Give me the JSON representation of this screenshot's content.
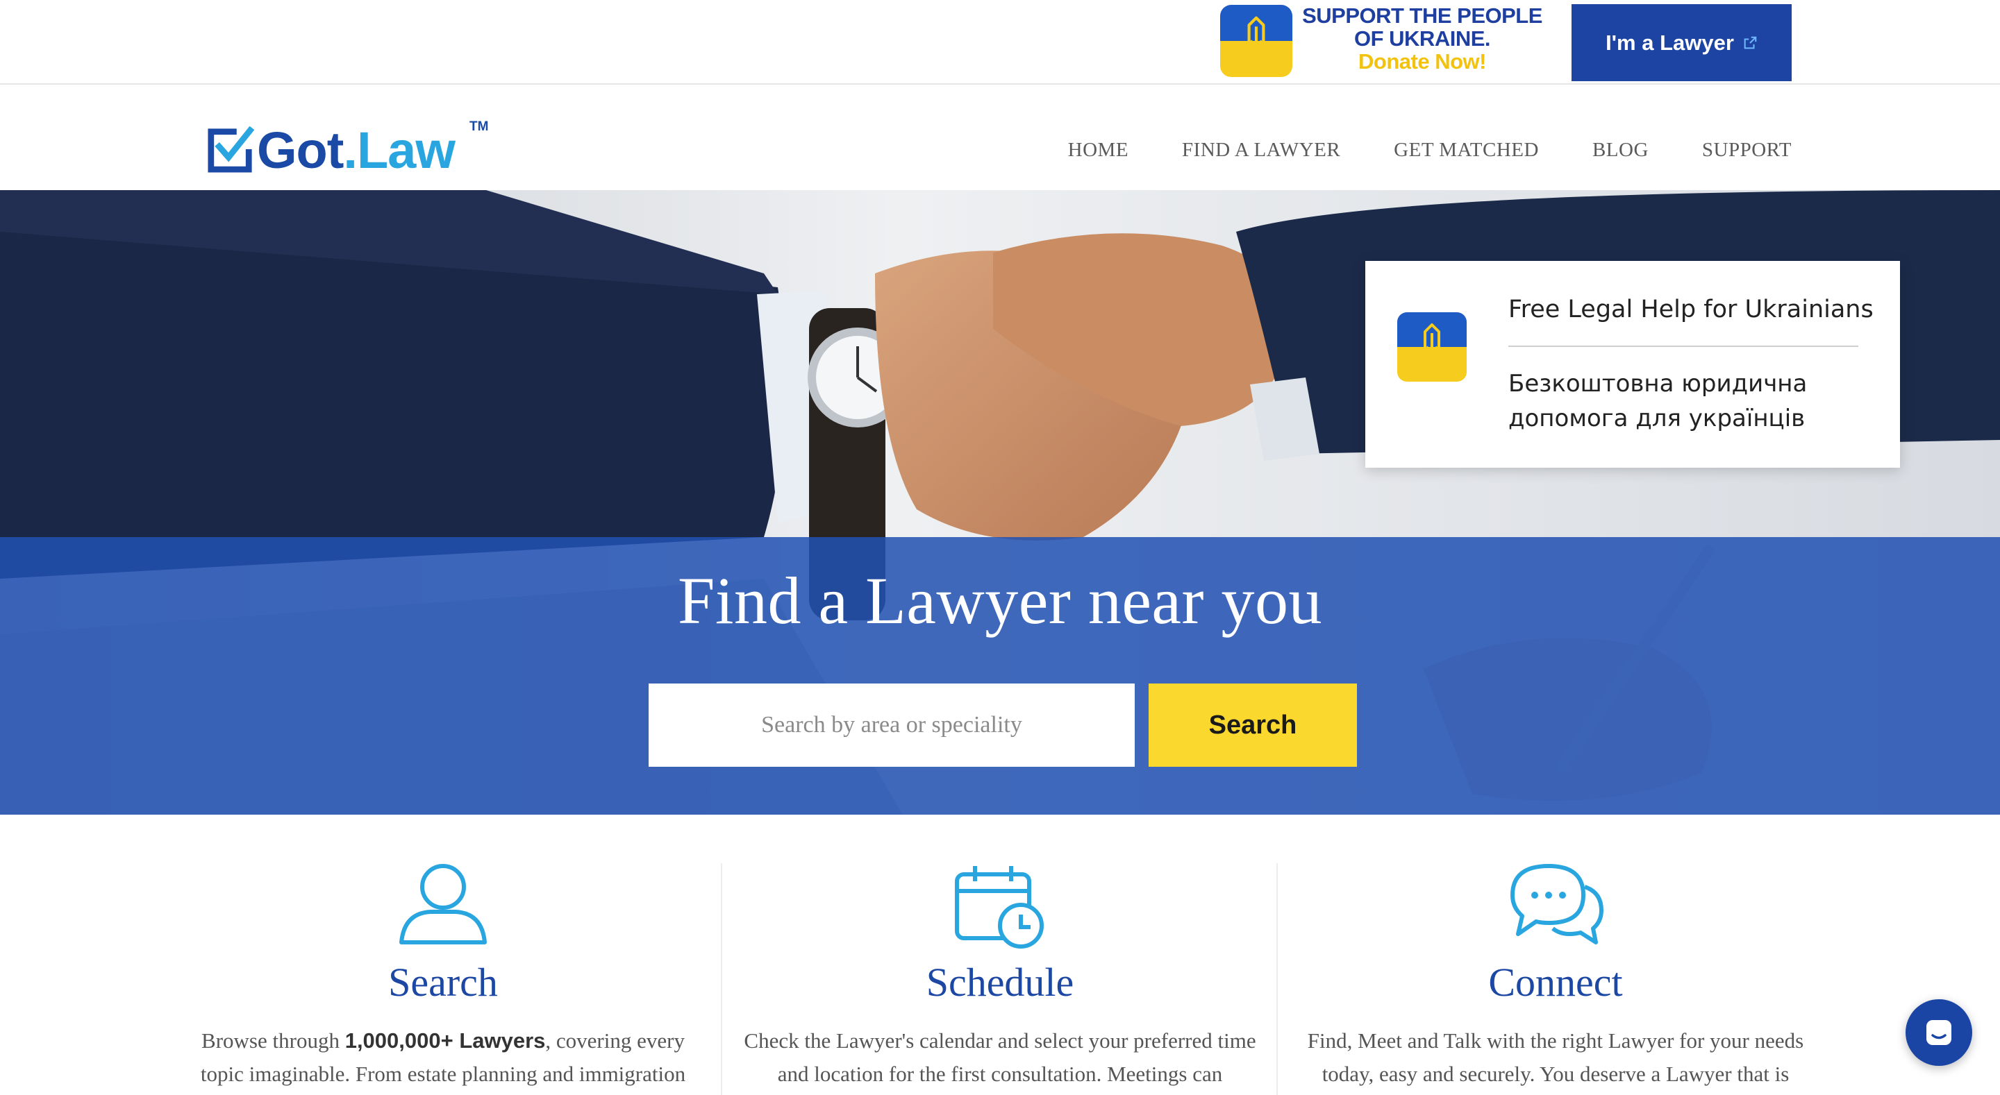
{
  "topbar": {
    "support_line1": "SUPPORT THE PEOPLE",
    "support_line2": "OF UKRAINE.",
    "support_line3": "Donate Now!",
    "lawyer_button": "I'm a Lawyer"
  },
  "logo": {
    "part1": "Got",
    "part2": ".Law",
    "tm": "TM"
  },
  "nav": {
    "items": [
      "HOME",
      "FIND A LAWYER",
      "GET MATCHED",
      "BLOG",
      "SUPPORT"
    ]
  },
  "ua_card": {
    "title": "Free Legal Help for Ukrainians",
    "subtitle": "Безкоштовна юридична допомога для українців"
  },
  "hero": {
    "title": "Find a Lawyer near you",
    "search_placeholder": "Search by area or speciality",
    "search_button": "Search"
  },
  "features": [
    {
      "icon": "user-icon",
      "title": "Search",
      "body_prefix": "Browse through ",
      "body_bold": "1,000,000+ Lawyers",
      "body_suffix": ", covering every topic imaginable. From estate planning and immigration"
    },
    {
      "icon": "calendar-clock-icon",
      "title": "Schedule",
      "body": "Check the Lawyer's calendar and select your preferred time and location for the first consultation. Meetings can"
    },
    {
      "icon": "chat-bubbles-icon",
      "title": "Connect",
      "body": "Find, Meet and Talk with the right Lawyer for your needs today, easy and securely. You deserve a Lawyer that is"
    }
  ],
  "colors": {
    "brand_blue": "#1d44a3",
    "accent_yellow": "#fbd82e",
    "light_blue": "#29a6e0"
  }
}
